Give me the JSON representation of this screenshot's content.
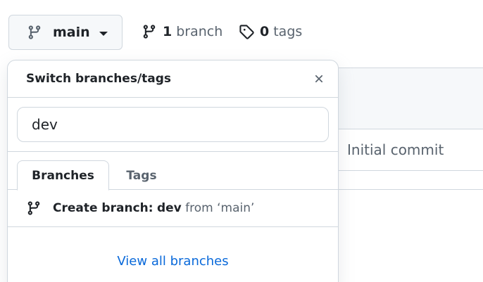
{
  "branch_button": {
    "label": "main"
  },
  "branches": {
    "count": "1",
    "label": "branch"
  },
  "tags": {
    "count": "0",
    "label": "tags"
  },
  "repo_table": {
    "commit_message": "Initial commit"
  },
  "dropdown": {
    "title": "Switch branches/tags",
    "filter_value": "dev",
    "tabs": [
      {
        "label": "Branches",
        "active": true
      },
      {
        "label": "Tags",
        "active": false
      }
    ],
    "create_prefix": "Create branch:",
    "create_name": "dev",
    "create_from": "from ‘main’",
    "footer_link": "View all branches"
  },
  "colors": {
    "accent_link": "#0969da",
    "text_primary": "#1f2328",
    "text_muted": "#59636e",
    "border": "#d0d7de"
  },
  "icons": {
    "branch": "git-branch-icon",
    "tag": "tag-icon",
    "close": "close-icon",
    "caret": "caret-down-icon"
  }
}
